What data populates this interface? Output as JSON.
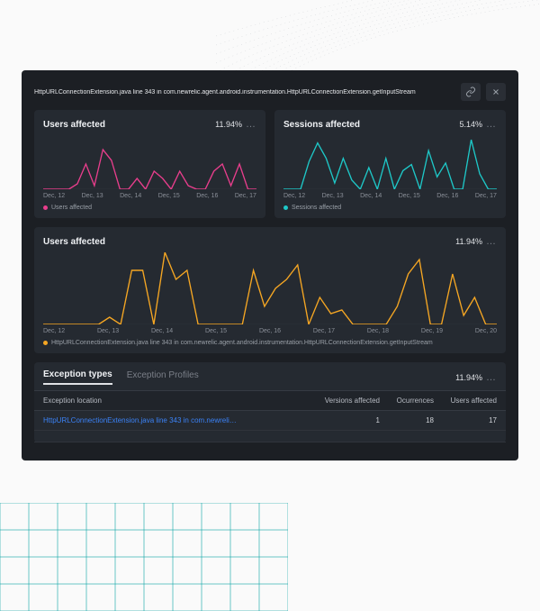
{
  "header": {
    "title": "HttpURLConnectionExtension.java line 343 in com.newrelic.agent.android.instrumentation.HttpURLConnectionExtension.getInputStream"
  },
  "colors": {
    "pink": "#e83e8c",
    "teal": "#1ec8c8",
    "orange": "#f5a623"
  },
  "cards": {
    "users_small": {
      "title": "Users affected",
      "stat": "11.94%",
      "legend": "Users affected"
    },
    "sessions_small": {
      "title": "Sessions affected",
      "stat": "5.14%",
      "legend": "Sessions affected"
    },
    "users_wide": {
      "title": "Users affected",
      "stat": "11.94%",
      "legend": "HttpURLConnectionExtension.java line 343 in com.newrelic.agent.android.instrumentation.HttpURLConnectionExtension.getInputStream"
    }
  },
  "chart_data": [
    {
      "type": "line",
      "title": "Users affected",
      "ylabel": "",
      "xlabel": "",
      "ylim": [
        0,
        30
      ],
      "categories": [
        "Dec, 12",
        "Dec, 13",
        "Dec, 14",
        "Dec, 15",
        "Dec, 16",
        "Dec, 17"
      ],
      "series": [
        {
          "name": "Users affected",
          "color": "#e83e8c",
          "values": [
            0,
            0,
            0,
            0,
            3,
            14,
            2,
            22,
            16,
            0,
            0,
            6,
            0,
            10,
            6,
            0,
            10,
            2,
            0,
            0,
            10,
            14,
            2,
            14,
            0,
            0
          ]
        }
      ]
    },
    {
      "type": "line",
      "title": "Sessions affected",
      "ylabel": "",
      "xlabel": "",
      "ylim": [
        0,
        35
      ],
      "categories": [
        "Dec, 12",
        "Dec, 13",
        "Dec, 14",
        "Dec, 15",
        "Dec, 16",
        "Dec, 17"
      ],
      "series": [
        {
          "name": "Sessions affected",
          "color": "#1ec8c8",
          "values": [
            0,
            0,
            0,
            18,
            30,
            20,
            4,
            20,
            6,
            0,
            14,
            0,
            20,
            0,
            12,
            16,
            0,
            25,
            8,
            17,
            0,
            0,
            32,
            10,
            0,
            0
          ]
        }
      ]
    },
    {
      "type": "line",
      "title": "Users affected",
      "ylabel": "",
      "xlabel": "",
      "ylim": [
        0,
        40
      ],
      "categories": [
        "Dec, 12",
        "Dec, 13",
        "Dec, 14",
        "Dec, 15",
        "Dec, 16",
        "Dec, 17",
        "Dec, 18",
        "Dec, 19",
        "Dec, 20"
      ],
      "series": [
        {
          "name": "HttpURLConnectionExtension",
          "color": "#f5a623",
          "values": [
            0,
            0,
            0,
            0,
            0,
            0,
            4,
            0,
            30,
            30,
            0,
            40,
            25,
            30,
            0,
            0,
            0,
            0,
            0,
            30,
            10,
            20,
            25,
            33,
            0,
            15,
            6,
            8,
            0,
            0,
            0,
            0,
            10,
            28,
            36,
            0,
            0,
            28,
            5,
            15,
            0,
            0
          ]
        }
      ]
    }
  ],
  "xaxis_small": [
    "Dec, 12",
    "Dec, 13",
    "Dec, 14",
    "Dec, 15",
    "Dec, 16",
    "Dec, 17"
  ],
  "xaxis_wide": [
    "Dec, 12",
    "Dec, 13",
    "Dec, 14",
    "Dec, 15",
    "Dec, 16",
    "Dec, 17",
    "Dec, 18",
    "Dec, 19",
    "Dec, 20"
  ],
  "tabs": {
    "t1": "Exception types",
    "t2": "Exception Profiles",
    "stat": "11.94%"
  },
  "table": {
    "headers": {
      "loc": "Exception location",
      "versions": "Versions affected",
      "occur": "Ocurrences",
      "users": "Users affected"
    },
    "row1": {
      "loc": "HttpURLConnectionExtension.java line 343 in com.newreli…",
      "versions": "1",
      "occur": "18",
      "users": "17"
    }
  },
  "more": "…"
}
